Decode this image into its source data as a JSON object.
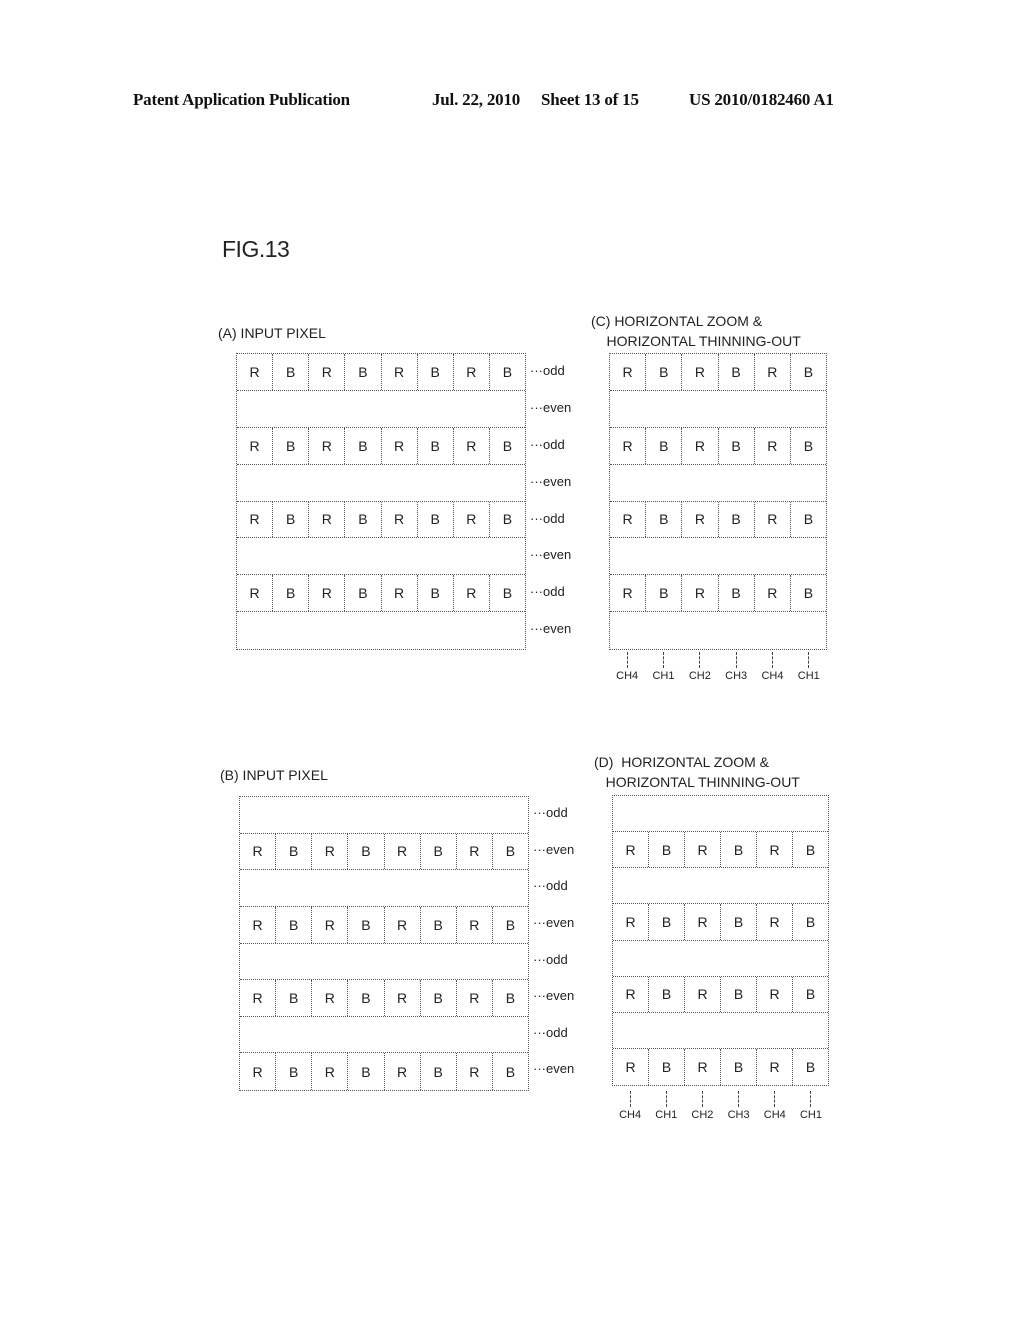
{
  "header": {
    "publication": "Patent Application Publication",
    "date": "Jul. 22, 2010",
    "sheet": "Sheet 13 of 15",
    "number": "US 2010/0182460 A1"
  },
  "figure_label": "FIG.13",
  "panels": {
    "A": {
      "title": "(A) INPUT PIXEL",
      "rows": [
        {
          "cells": [
            "R",
            "B",
            "R",
            "B",
            "R",
            "B",
            "R",
            "B"
          ],
          "label": "···odd"
        },
        {
          "cells": [],
          "label": "···even"
        },
        {
          "cells": [
            "R",
            "B",
            "R",
            "B",
            "R",
            "B",
            "R",
            "B"
          ],
          "label": "···odd"
        },
        {
          "cells": [],
          "label": "···even"
        },
        {
          "cells": [
            "R",
            "B",
            "R",
            "B",
            "R",
            "B",
            "R",
            "B"
          ],
          "label": "···odd"
        },
        {
          "cells": [],
          "label": "···even"
        },
        {
          "cells": [
            "R",
            "B",
            "R",
            "B",
            "R",
            "B",
            "R",
            "B"
          ],
          "label": "···odd"
        },
        {
          "cells": [],
          "label": "···even"
        }
      ]
    },
    "B": {
      "title": "(B) INPUT PIXEL",
      "rows": [
        {
          "cells": [],
          "label": "···odd"
        },
        {
          "cells": [
            "R",
            "B",
            "R",
            "B",
            "R",
            "B",
            "R",
            "B"
          ],
          "label": "···even"
        },
        {
          "cells": [],
          "label": "···odd"
        },
        {
          "cells": [
            "R",
            "B",
            "R",
            "B",
            "R",
            "B",
            "R",
            "B"
          ],
          "label": "···even"
        },
        {
          "cells": [],
          "label": "···odd"
        },
        {
          "cells": [
            "R",
            "B",
            "R",
            "B",
            "R",
            "B",
            "R",
            "B"
          ],
          "label": "···even"
        },
        {
          "cells": [],
          "label": "···odd"
        },
        {
          "cells": [
            "R",
            "B",
            "R",
            "B",
            "R",
            "B",
            "R",
            "B"
          ],
          "label": "···even"
        }
      ]
    },
    "C": {
      "title": "(C) HORIZONTAL ZOOM &\n    HORIZONTAL THINNING-OUT",
      "rows": [
        {
          "cells": [
            "R",
            "B",
            "R",
            "B",
            "R",
            "B"
          ]
        },
        {
          "cells": []
        },
        {
          "cells": [
            "R",
            "B",
            "R",
            "B",
            "R",
            "B"
          ]
        },
        {
          "cells": []
        },
        {
          "cells": [
            "R",
            "B",
            "R",
            "B",
            "R",
            "B"
          ]
        },
        {
          "cells": []
        },
        {
          "cells": [
            "R",
            "B",
            "R",
            "B",
            "R",
            "B"
          ]
        },
        {
          "cells": []
        }
      ],
      "channels": [
        "CH4",
        "CH1",
        "CH2",
        "CH3",
        "CH4",
        "CH1"
      ]
    },
    "D": {
      "title": "(D)  HORIZONTAL ZOOM &\n   HORIZONTAL THINNING-OUT",
      "rows": [
        {
          "cells": []
        },
        {
          "cells": [
            "R",
            "B",
            "R",
            "B",
            "R",
            "B"
          ]
        },
        {
          "cells": []
        },
        {
          "cells": [
            "R",
            "B",
            "R",
            "B",
            "R",
            "B"
          ]
        },
        {
          "cells": []
        },
        {
          "cells": [
            "R",
            "B",
            "R",
            "B",
            "R",
            "B"
          ]
        },
        {
          "cells": []
        },
        {
          "cells": [
            "R",
            "B",
            "R",
            "B",
            "R",
            "B"
          ]
        }
      ],
      "channels": [
        "CH4",
        "CH1",
        "CH2",
        "CH3",
        "CH4",
        "CH1"
      ]
    }
  }
}
